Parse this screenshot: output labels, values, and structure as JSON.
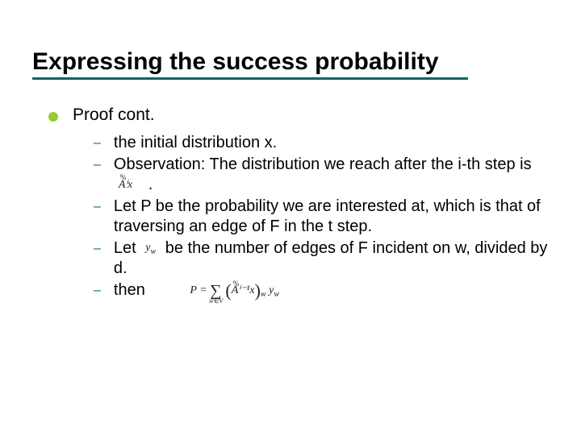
{
  "title": "Expressing the success probability",
  "level1": "Proof cont.",
  "items": [
    "the initial distribution x.",
    "Observation: The distribution we reach after the i-th step is",
    ".",
    "Let P be the probability we are interested at, which is that of traversing an edge of F in the t step.",
    "Let",
    "be the number of edges of F incident on w, divided by d.",
    "then"
  ],
  "formulas": {
    "f1_sup": "%",
    "f1_base": "Aⁱx",
    "f2": "y",
    "f2_sub": "w",
    "eq_P": "P =",
    "eq_sigma": "∑",
    "eq_sigma_sub": "w∈V",
    "eq_lparen": "(",
    "eq_inner_sup": "%",
    "eq_inner": "Aⁱ⁻¹x",
    "eq_rparen": ")",
    "eq_sub_w": "w",
    "eq_y": " y",
    "eq_y_sub": "w"
  }
}
